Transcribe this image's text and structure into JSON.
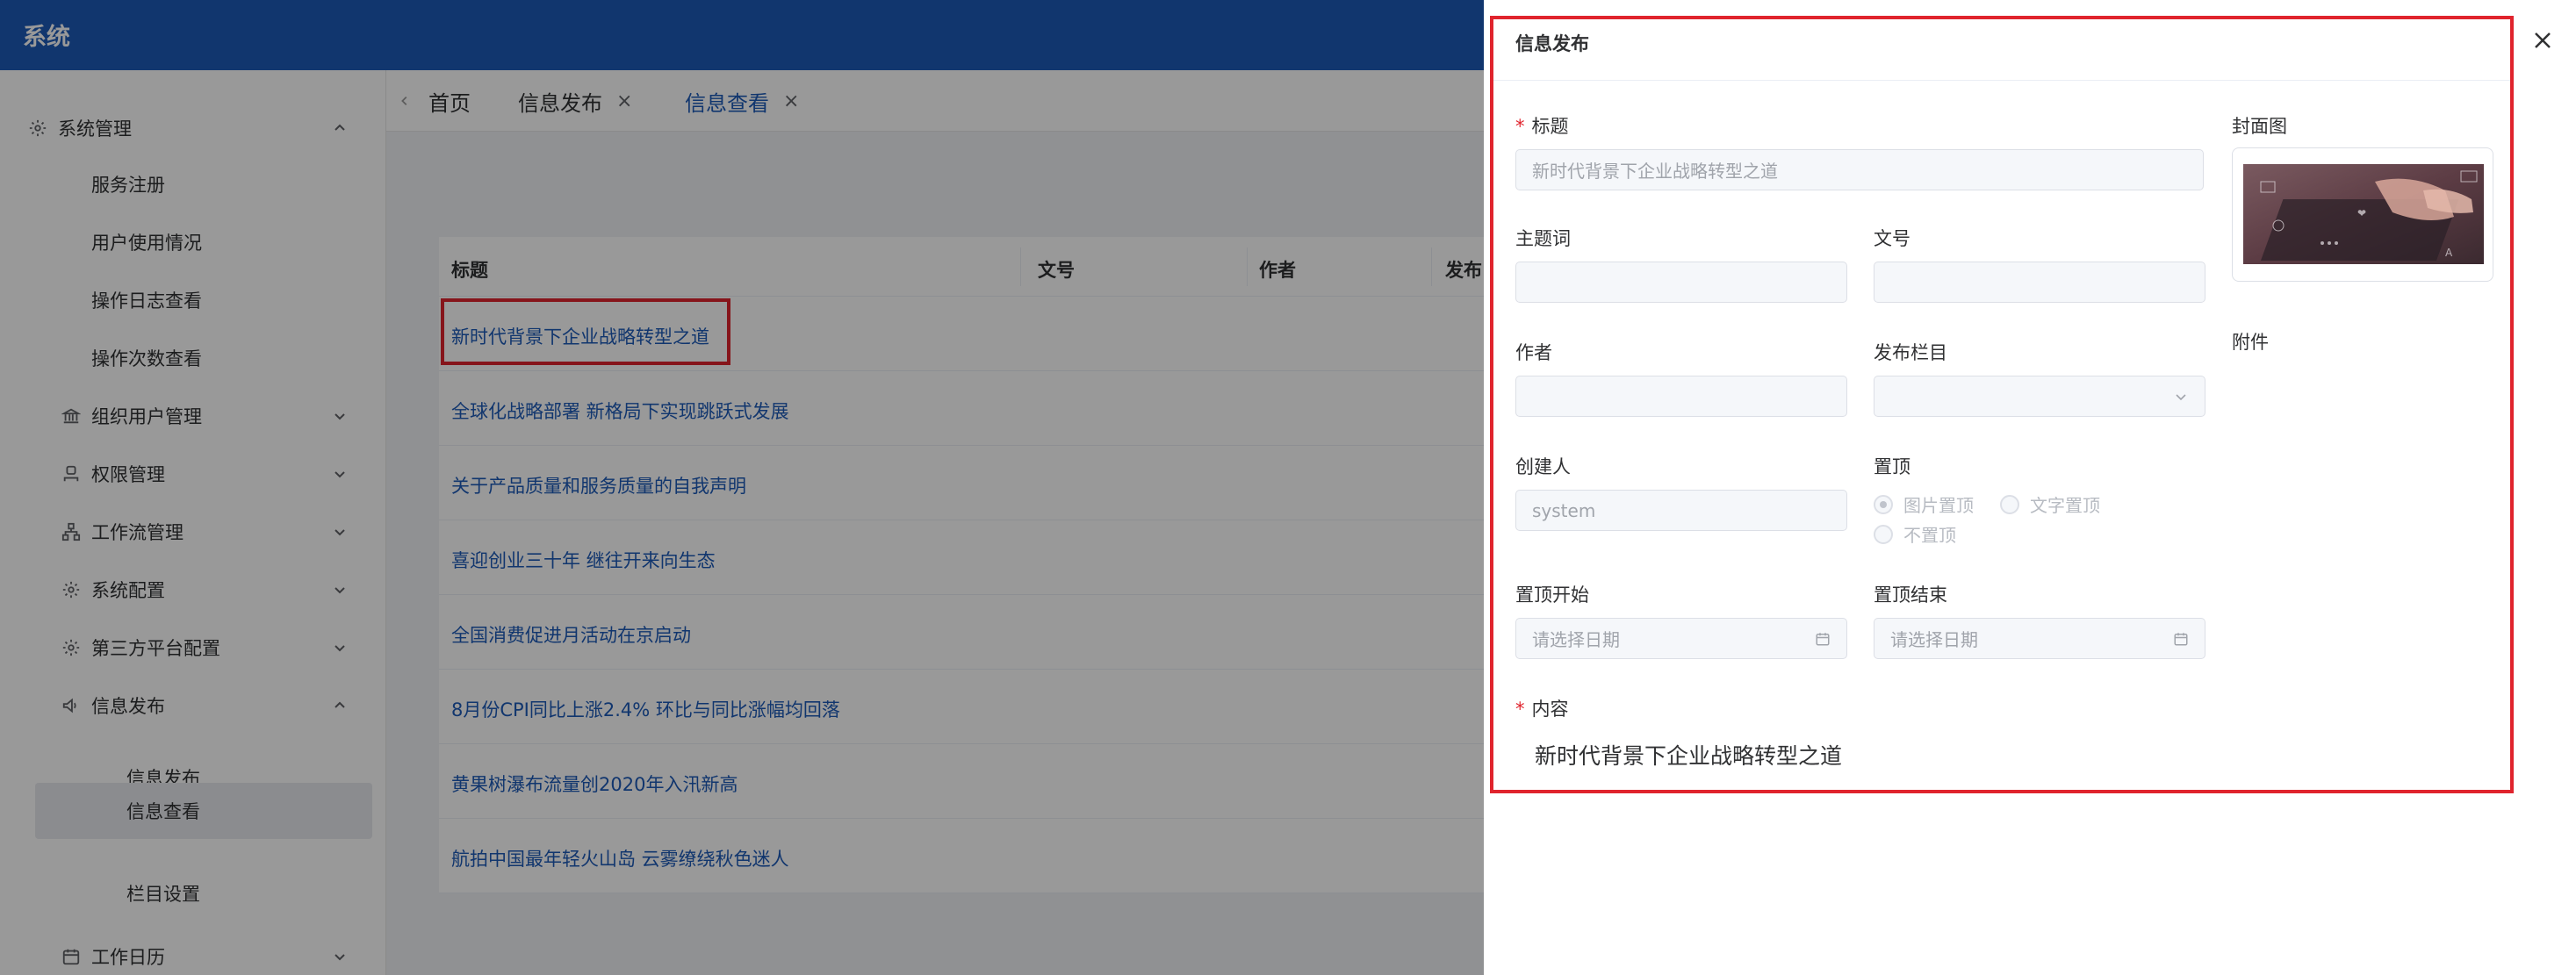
{
  "app": {
    "title": "系统"
  },
  "sidebar": {
    "items": [
      {
        "label": "系统管理",
        "icon": "gear-icon",
        "expanded": true
      },
      {
        "label": "服务注册"
      },
      {
        "label": "用户使用情况"
      },
      {
        "label": "操作日志查看"
      },
      {
        "label": "操作次数查看"
      },
      {
        "label": "组织用户管理",
        "icon": "bank-icon"
      },
      {
        "label": "权限管理",
        "icon": "user-icon"
      },
      {
        "label": "工作流管理",
        "icon": "flow-icon"
      },
      {
        "label": "系统配置",
        "icon": "gear-icon"
      },
      {
        "label": "第三方平台配置",
        "icon": "gear-icon"
      },
      {
        "label": "信息发布",
        "icon": "megaphone-icon",
        "expanded": true
      },
      {
        "label": "信息发布"
      },
      {
        "label": "信息查看",
        "active": true
      },
      {
        "label": "栏目设置"
      },
      {
        "label": "工作日历",
        "icon": "calendar-icon"
      }
    ]
  },
  "tabs": [
    {
      "label": "首页"
    },
    {
      "label": "信息发布"
    },
    {
      "label": "信息查看",
      "active": true
    }
  ],
  "table": {
    "headers": [
      "标题",
      "文号",
      "作者",
      "发布"
    ],
    "rows": [
      "新时代背景下企业战略转型之道",
      "全球化战略部署 新格局下实现跳跃式发展",
      "关于产品质量和服务质量的自我声明",
      "喜迎创业三十年 继往开来向生态",
      "全国消费促进月活动在京启动",
      "8月份CPI同比上涨2.4% 环比与同比涨幅均回落",
      "黄果树瀑布流量创2020年入汛新高",
      "航拍中国最年轻火山岛 云雾缭绕秋色迷人"
    ]
  },
  "drawer": {
    "title": "信息发布",
    "close_label": "×",
    "fields": {
      "title_label": "标题",
      "title_value": "新时代背景下企业战略转型之道",
      "keywords_label": "主题词",
      "doc_no_label": "文号",
      "author_label": "作者",
      "column_label": "发布栏目",
      "creator_label": "创建人",
      "creator_value": "system",
      "top_label": "置顶",
      "top_options": [
        "图片置顶",
        "文字置顶",
        "不置顶"
      ],
      "top_start_label": "置顶开始",
      "top_start_placeholder": "请选择日期",
      "top_end_label": "置顶结束",
      "top_end_placeholder": "请选择日期",
      "content_label": "内容",
      "content_value": "新时代背景下企业战略转型之道",
      "cover_label": "封面图",
      "attachment_label": "附件"
    }
  },
  "colors": {
    "brand": "#1d5ab8",
    "highlight": "#e0242d",
    "required": "#e0242d"
  }
}
